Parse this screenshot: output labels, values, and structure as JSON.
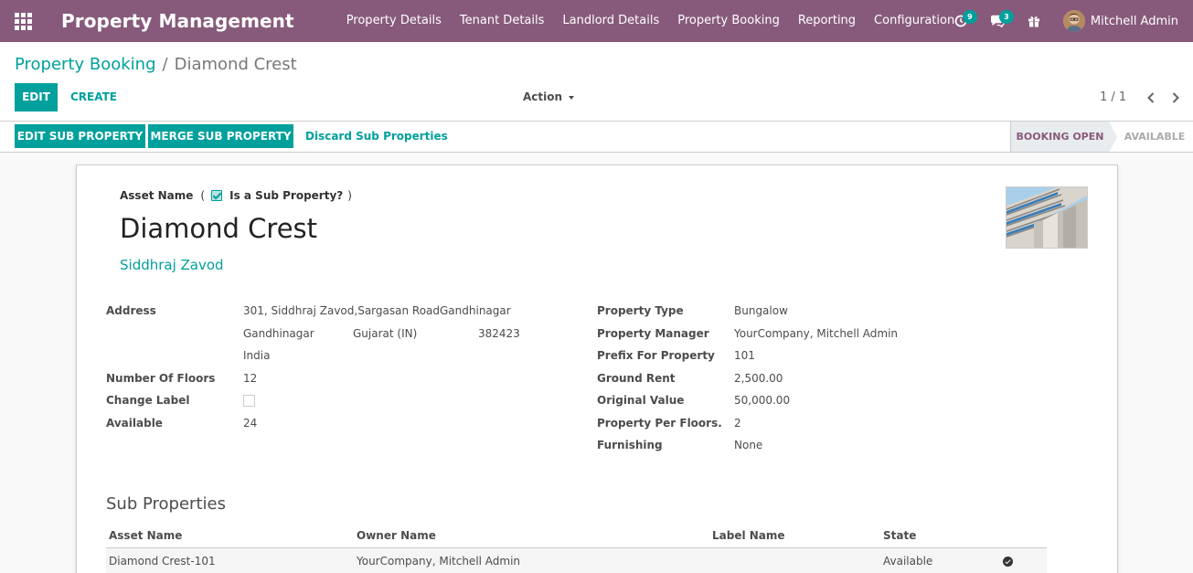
{
  "navbar": {
    "brand": "Property Management",
    "menu": [
      "Property Details",
      "Tenant Details",
      "Landlord Details",
      "Property Booking",
      "Reporting",
      "Configuration"
    ],
    "activity_badge": "9",
    "messages_badge": "3",
    "user_name": "Mitchell Admin",
    "color": "#875a7b"
  },
  "control_panel": {
    "breadcrumb_parent": "Property Booking",
    "breadcrumb_separator": "/",
    "breadcrumb_current": "Diamond Crest",
    "edit_label": "EDIT",
    "create_label": "CREATE",
    "action_label": "Action",
    "pager": "1 / 1"
  },
  "statusbar": {
    "edit_sub_property": "EDIT SUB PROPERTY",
    "merge_sub_property": "MERGE SUB PROPERTY",
    "discard_sub_properties": "Discard Sub Properties",
    "stages": [
      {
        "label": "BOOKING OPEN",
        "active": true
      },
      {
        "label": "AVAILABLE",
        "active": false
      }
    ]
  },
  "form": {
    "asset_name_label": "Asset Name",
    "paren_open": "(",
    "paren_close": ")",
    "is_sub_property_label": "Is a Sub Property?",
    "is_sub_property": true,
    "name": "Diamond Crest",
    "owner": "Siddhraj Zavod",
    "left_fields": {
      "address_label": "Address",
      "address_street": "301, Siddhraj Zavod,Sargasan RoadGandhinagar",
      "address_city": "Gandhinagar",
      "address_state": "Gujarat (IN)",
      "address_zip": "382423",
      "address_country": "India",
      "floors_label": "Number Of Floors",
      "floors_value": "12",
      "change_label_label": "Change Label",
      "change_label_checked": false,
      "available_label": "Available",
      "available_value": "24"
    },
    "right_fields": [
      {
        "label": "Property Type",
        "value": "Bungalow"
      },
      {
        "label": "Property Manager",
        "value": "YourCompany, Mitchell Admin"
      },
      {
        "label": "Prefix For Property",
        "value": "101"
      },
      {
        "label": "Ground Rent",
        "value": "2,500.00"
      },
      {
        "label": "Original Value",
        "value": "50,000.00"
      },
      {
        "label": "Property Per Floors.",
        "value": "2"
      },
      {
        "label": "Furnishing",
        "value": "None"
      }
    ]
  },
  "sub_properties": {
    "title": "Sub Properties",
    "columns": [
      "Asset Name",
      "Owner Name",
      "Label Name",
      "State"
    ],
    "rows": [
      {
        "asset_name": "Diamond Crest-101",
        "owner_name": "YourCompany, Mitchell Admin",
        "label_name": "",
        "state": "Available"
      }
    ]
  }
}
